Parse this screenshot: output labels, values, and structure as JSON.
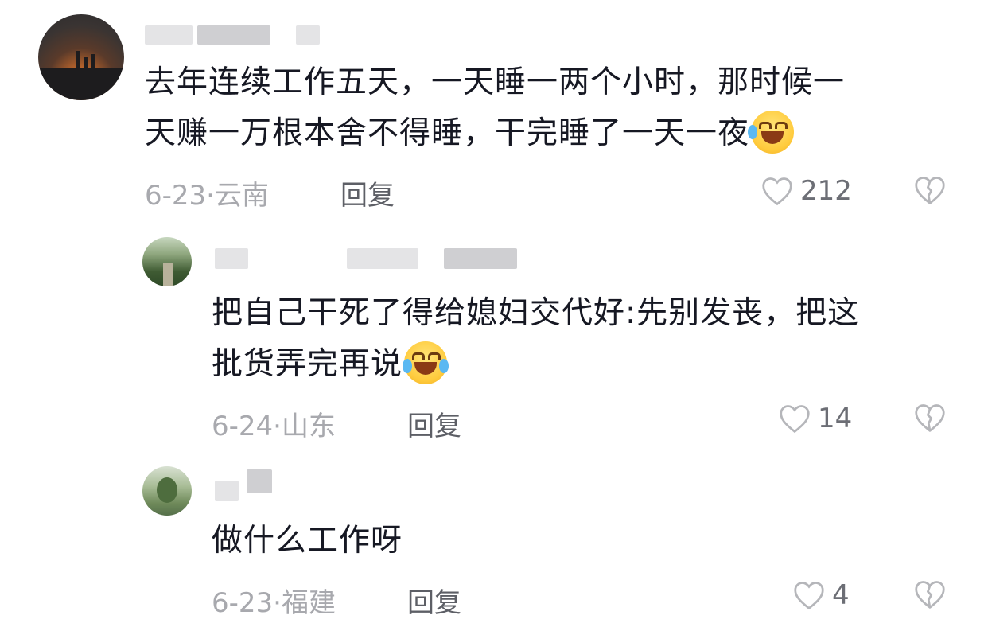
{
  "comments": [
    {
      "text_lines": [
        "去年连续工作五天，一天睡一两个小时，那时候一",
        "天赚一万根本舍不得睡，干完睡了一天一夜"
      ],
      "emoji": "rofl-emoji",
      "date_location": "6-23·云南",
      "reply_label": "回复",
      "like_count": "212"
    },
    {
      "text_lines": [
        "把自己干死了得给媳妇交代好:先别发丧，把这",
        "批货弄完再说"
      ],
      "emoji": "crying-laughing-emoji",
      "date_location": "6-24·山东",
      "reply_label": "回复",
      "like_count": "14"
    },
    {
      "text_lines": [
        "做什么工作呀"
      ],
      "date_location": "6-23·福建",
      "reply_label": "回复",
      "like_count": "4"
    }
  ],
  "colors": {
    "text": "#161823",
    "meta": "#a8a9ae",
    "reply": "#5d5f66",
    "icon": "#b5b6ba"
  }
}
